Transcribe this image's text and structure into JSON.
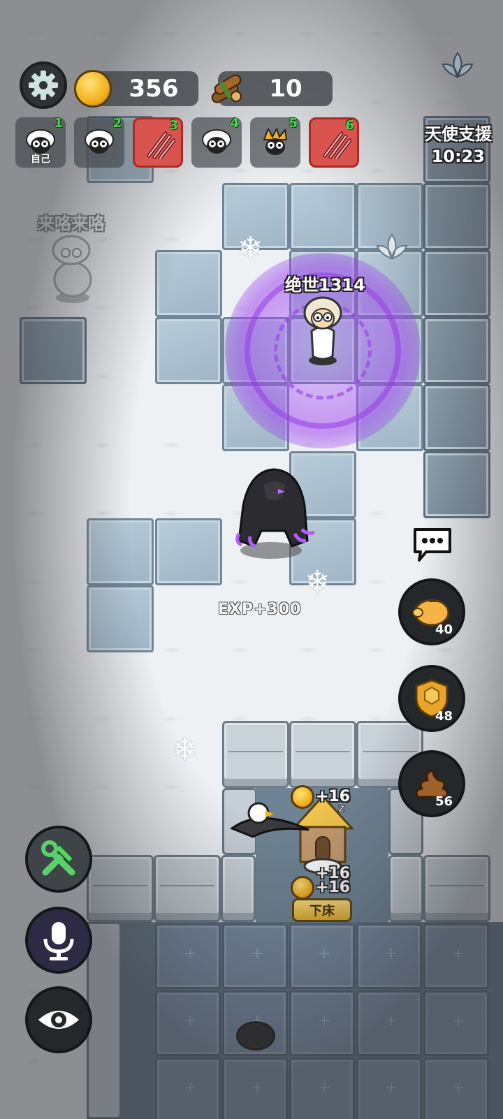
{
  "hud": {
    "coins": "356",
    "wood": "10"
  },
  "players": [
    {
      "num": "1",
      "tag": "自己",
      "type": "sheep",
      "warn": false
    },
    {
      "num": "2",
      "type": "sheep",
      "warn": false
    },
    {
      "num": "3",
      "type": "claw",
      "warn": true
    },
    {
      "num": "4",
      "type": "sheep",
      "warn": false
    },
    {
      "num": "5",
      "type": "spiky-sheep",
      "warn": false
    },
    {
      "num": "6",
      "type": "claw",
      "warn": true
    }
  ],
  "angel_support": {
    "title": "天使支援",
    "timer": "10:23"
  },
  "characters": {
    "ghost_name": "来咯来咯",
    "player_name": "绝世1314"
  },
  "effects": {
    "exp_text": "EXP+300",
    "gains": [
      "+16",
      "+16",
      "+16"
    ]
  },
  "side_buttons": {
    "piggy_count": "40",
    "shield_count": "48",
    "poop_count": "56"
  },
  "bed_button": "下床",
  "colors": {
    "magic": "#a050f0",
    "coin": "#f2b21c",
    "warn_slot": "#d9534f"
  }
}
